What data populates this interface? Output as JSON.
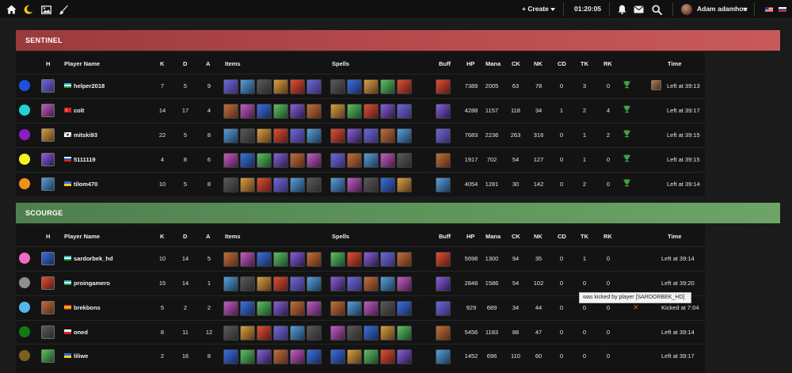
{
  "topbar": {
    "icons": [
      "home-icon",
      "moon-icon",
      "image-icon",
      "brush-icon"
    ],
    "create_label": "+ Create",
    "clock": "01:20:05",
    "user_name": "Adam adamhox"
  },
  "columns": {
    "h": "H",
    "player": "Player Name",
    "k": "K",
    "d": "D",
    "a": "A",
    "items": "Items",
    "spells": "Spells",
    "buff": "Buff",
    "hp": "HP",
    "mana": "Mana",
    "ck": "CK",
    "nk": "NK",
    "cd": "CD",
    "tk": "TK",
    "rk": "RK",
    "time": "Time"
  },
  "sentinel": {
    "title": "SENTINEL",
    "players": [
      {
        "color": "#1f4fe0",
        "flag": "uz",
        "name": "helper2018",
        "k": "7",
        "d": "5",
        "a": "9",
        "hp": "7389",
        "mana": "2005",
        "ck": "63",
        "nk": "78",
        "cd": "0",
        "tk": "3",
        "rk": "0",
        "trophy": true,
        "time": "Left at 39:13"
      },
      {
        "color": "#22d3d3",
        "flag": "tr",
        "name": "colt",
        "k": "14",
        "d": "17",
        "a": "4",
        "hp": "4288",
        "mana": "1157",
        "ck": "118",
        "nk": "34",
        "cd": "1",
        "tk": "2",
        "rk": "4",
        "trophy": true,
        "time": "Left at 39:17"
      },
      {
        "color": "#8a1fc0",
        "flag": "kr",
        "name": "mitski93",
        "k": "22",
        "d": "5",
        "a": "8",
        "hp": "7683",
        "mana": "2236",
        "ck": "263",
        "nk": "316",
        "cd": "0",
        "tk": "1",
        "rk": "2",
        "trophy": true,
        "time": "Left at 39:15"
      },
      {
        "color": "#f4f41a",
        "flag": "ru",
        "name": "5111119",
        "k": "4",
        "d": "8",
        "a": "6",
        "hp": "1917",
        "mana": "702",
        "ck": "54",
        "nk": "127",
        "cd": "0",
        "tk": "1",
        "rk": "0",
        "trophy": true,
        "time": "Left at 39:15"
      },
      {
        "color": "#f0901c",
        "flag": "ua",
        "name": "tilom470",
        "k": "10",
        "d": "5",
        "a": "8",
        "hp": "4054",
        "mana": "1281",
        "ck": "30",
        "nk": "142",
        "cd": "0",
        "tk": "2",
        "rk": "0",
        "trophy": true,
        "time": "Left at 39:14"
      }
    ]
  },
  "scourge": {
    "title": "SCOURGE",
    "players": [
      {
        "color": "#f06ac8",
        "flag": "uz",
        "name": "sardorbek_hd",
        "k": "10",
        "d": "14",
        "a": "5",
        "hp": "5698",
        "mana": "1300",
        "ck": "94",
        "nk": "35",
        "cd": "0",
        "tk": "1",
        "rk": "0",
        "trophy": false,
        "time": "Left at 39:14"
      },
      {
        "color": "#8e8e8e",
        "flag": "uz",
        "name": "proingamero",
        "k": "15",
        "d": "14",
        "a": "1",
        "hp": "2848",
        "mana": "1586",
        "ck": "54",
        "nk": "102",
        "cd": "0",
        "tk": "0",
        "rk": "0",
        "trophy": false,
        "time": "Left at 39:20"
      },
      {
        "color": "#56b8e8",
        "flag": "es",
        "name": "brekbons",
        "k": "5",
        "d": "2",
        "a": "2",
        "hp": "929",
        "mana": "689",
        "ck": "34",
        "nk": "44",
        "cd": "0",
        "tk": "0",
        "rk": "0",
        "trophy": false,
        "kicked": true,
        "time": "Kicked at 7:04"
      },
      {
        "color": "#137a13",
        "flag": "pl",
        "name": "oned",
        "k": "8",
        "d": "11",
        "a": "12",
        "hp": "5456",
        "mana": "1183",
        "ck": "88",
        "nk": "47",
        "cd": "0",
        "tk": "0",
        "rk": "0",
        "trophy": false,
        "time": "Left at 39:14"
      },
      {
        "color": "#7a5f1f",
        "flag": "ua",
        "name": "liliwe",
        "k": "2",
        "d": "16",
        "a": "8",
        "hp": "1452",
        "mana": "696",
        "ck": "110",
        "nk": "60",
        "cd": "0",
        "tk": "0",
        "rk": "0",
        "trophy": false,
        "time": "Left at 39:17"
      }
    ]
  },
  "tooltip": "was kicked by player [SARDORBEK_HD]"
}
